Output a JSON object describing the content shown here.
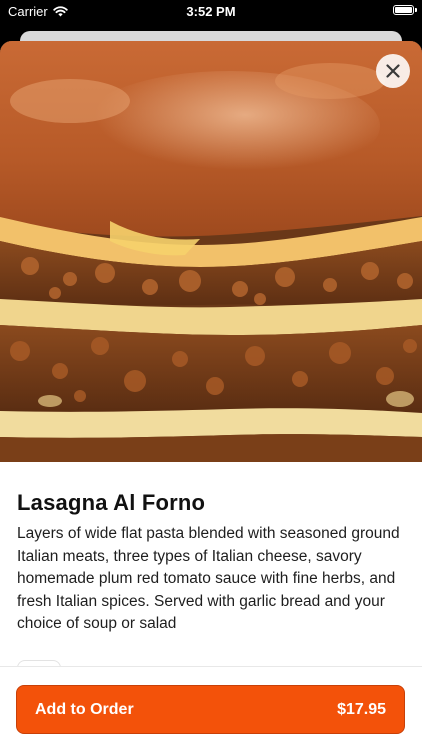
{
  "status_bar": {
    "carrier": "Carrier",
    "time": "3:52 PM",
    "wifi_icon": "wifi-icon",
    "battery_icon": "battery-icon"
  },
  "item": {
    "image_icon": "lasagna-photo",
    "close_icon": "close-icon",
    "title": "Lasagna Al Forno",
    "description": "Layers of wide flat pasta blended with seasoned ground Italian meats, three types of Italian cheese, savory homemade plum red tomato sauce with fine herbs, and fresh Italian spices. Served with garlic bread and your choice of soup or salad"
  },
  "footer": {
    "add_label": "Add to Order",
    "price": "$17.95"
  },
  "colors": {
    "accent": "#f3520a",
    "text": "#111111"
  }
}
